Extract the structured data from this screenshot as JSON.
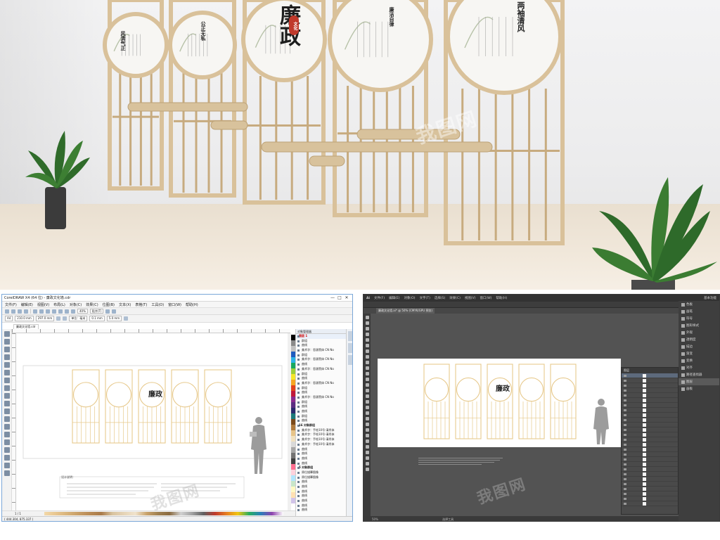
{
  "render": {
    "panels": [
      {
        "title": "风清气正"
      },
      {
        "title": "公正无私"
      },
      {
        "title": "廉政",
        "seal": "文化"
      },
      {
        "title": "廉洁自律"
      },
      {
        "title": "两袖清风"
      }
    ],
    "watermarks": [
      "我图网",
      "我图网"
    ]
  },
  "corel": {
    "title": "CorelDRAW X4 (64 位) - 廉政文化墙.cdr",
    "window_buttons": [
      "—",
      "□",
      "✕"
    ],
    "menu": [
      "文件(F)",
      "编辑(E)",
      "视图(V)",
      "布局(L)",
      "对象(C)",
      "效果(C)",
      "位图(B)",
      "文本(X)",
      "表格(T)",
      "工具(O)",
      "窗口(W)",
      "帮助(H)"
    ],
    "toolbar": {
      "zoom": "40%",
      "snap": "贴齐(T)",
      "unit_label": "单位：毫米",
      "nudge": "0.1 mm",
      "dup": "5.0 mm"
    },
    "propbar": {
      "paper": "A4",
      "width": "210.0 mm",
      "height": "297.0 mm"
    },
    "doc_tab": "廉政文化墙.cdr",
    "objmgr": {
      "title": "对象管理器",
      "rows": [
        {
          "text": "图层 1",
          "group": true,
          "selected": true
        },
        {
          "text": "群组"
        },
        {
          "text": "曲线"
        },
        {
          "text": "美术字：思源黑体 CN No"
        },
        {
          "text": "群组"
        },
        {
          "text": "美术字：思源黑体 CN No"
        },
        {
          "text": "曲线"
        },
        {
          "text": "美术字：思源黑体 CN No"
        },
        {
          "text": "群组"
        },
        {
          "text": "曲线"
        },
        {
          "text": "美术字：思源黑体 CN No"
        },
        {
          "text": "群组"
        },
        {
          "text": "曲线"
        },
        {
          "text": "美术字：思源黑体 CN No"
        },
        {
          "text": "群组"
        },
        {
          "text": "曲线"
        },
        {
          "text": "曲线"
        },
        {
          "text": "群组"
        },
        {
          "text": "曲线"
        },
        {
          "text": "16 对象群组",
          "group": true
        },
        {
          "text": "美术字：手绘10号-清秀体"
        },
        {
          "text": "美术字：手绘10号-清秀体"
        },
        {
          "text": "美术字：手绘10号-清秀体"
        },
        {
          "text": "美术字：手绘10号-清秀体"
        },
        {
          "text": "曲线"
        },
        {
          "text": "曲线"
        },
        {
          "text": "曲线"
        },
        {
          "text": "曲线"
        },
        {
          "text": "5 对象群组",
          "group": true
        },
        {
          "text": "原位描摹图像"
        },
        {
          "text": "原位描摹图像"
        },
        {
          "text": "曲线"
        },
        {
          "text": "曲线"
        },
        {
          "text": "曲线"
        },
        {
          "text": "曲线"
        },
        {
          "text": "曲线"
        },
        {
          "text": "曲线"
        },
        {
          "text": "曲线"
        }
      ]
    },
    "page_nav": "1 / 1",
    "status": "( 444.304, 875.337 )",
    "notes_title": "设计说明："
  },
  "illus": {
    "menu": [
      "文件(F)",
      "编辑(E)",
      "对象(O)",
      "文字(T)",
      "选择(S)",
      "效果(C)",
      "视图(V)",
      "窗口(W)",
      "帮助(H)"
    ],
    "workspace": "基本功能",
    "doc_tab": "廉政文化墙.ai* @ 50% (CMYK/GPU 预览)",
    "right_panels": [
      "色板",
      "画笔",
      "符号",
      "图形样式",
      "外观",
      "透明度",
      "描边",
      "渐变",
      "变换",
      "对齐",
      "路径查找器",
      "图层",
      "画板"
    ],
    "layers_title": "图层",
    "status": "选择工具",
    "zoom": "50%"
  },
  "colors": {
    "wood": "#d9c19a",
    "wood_dark": "#c7ab7f",
    "outline": "#e7c98c",
    "ink": "#222222",
    "seal_red": "#c0392b"
  }
}
